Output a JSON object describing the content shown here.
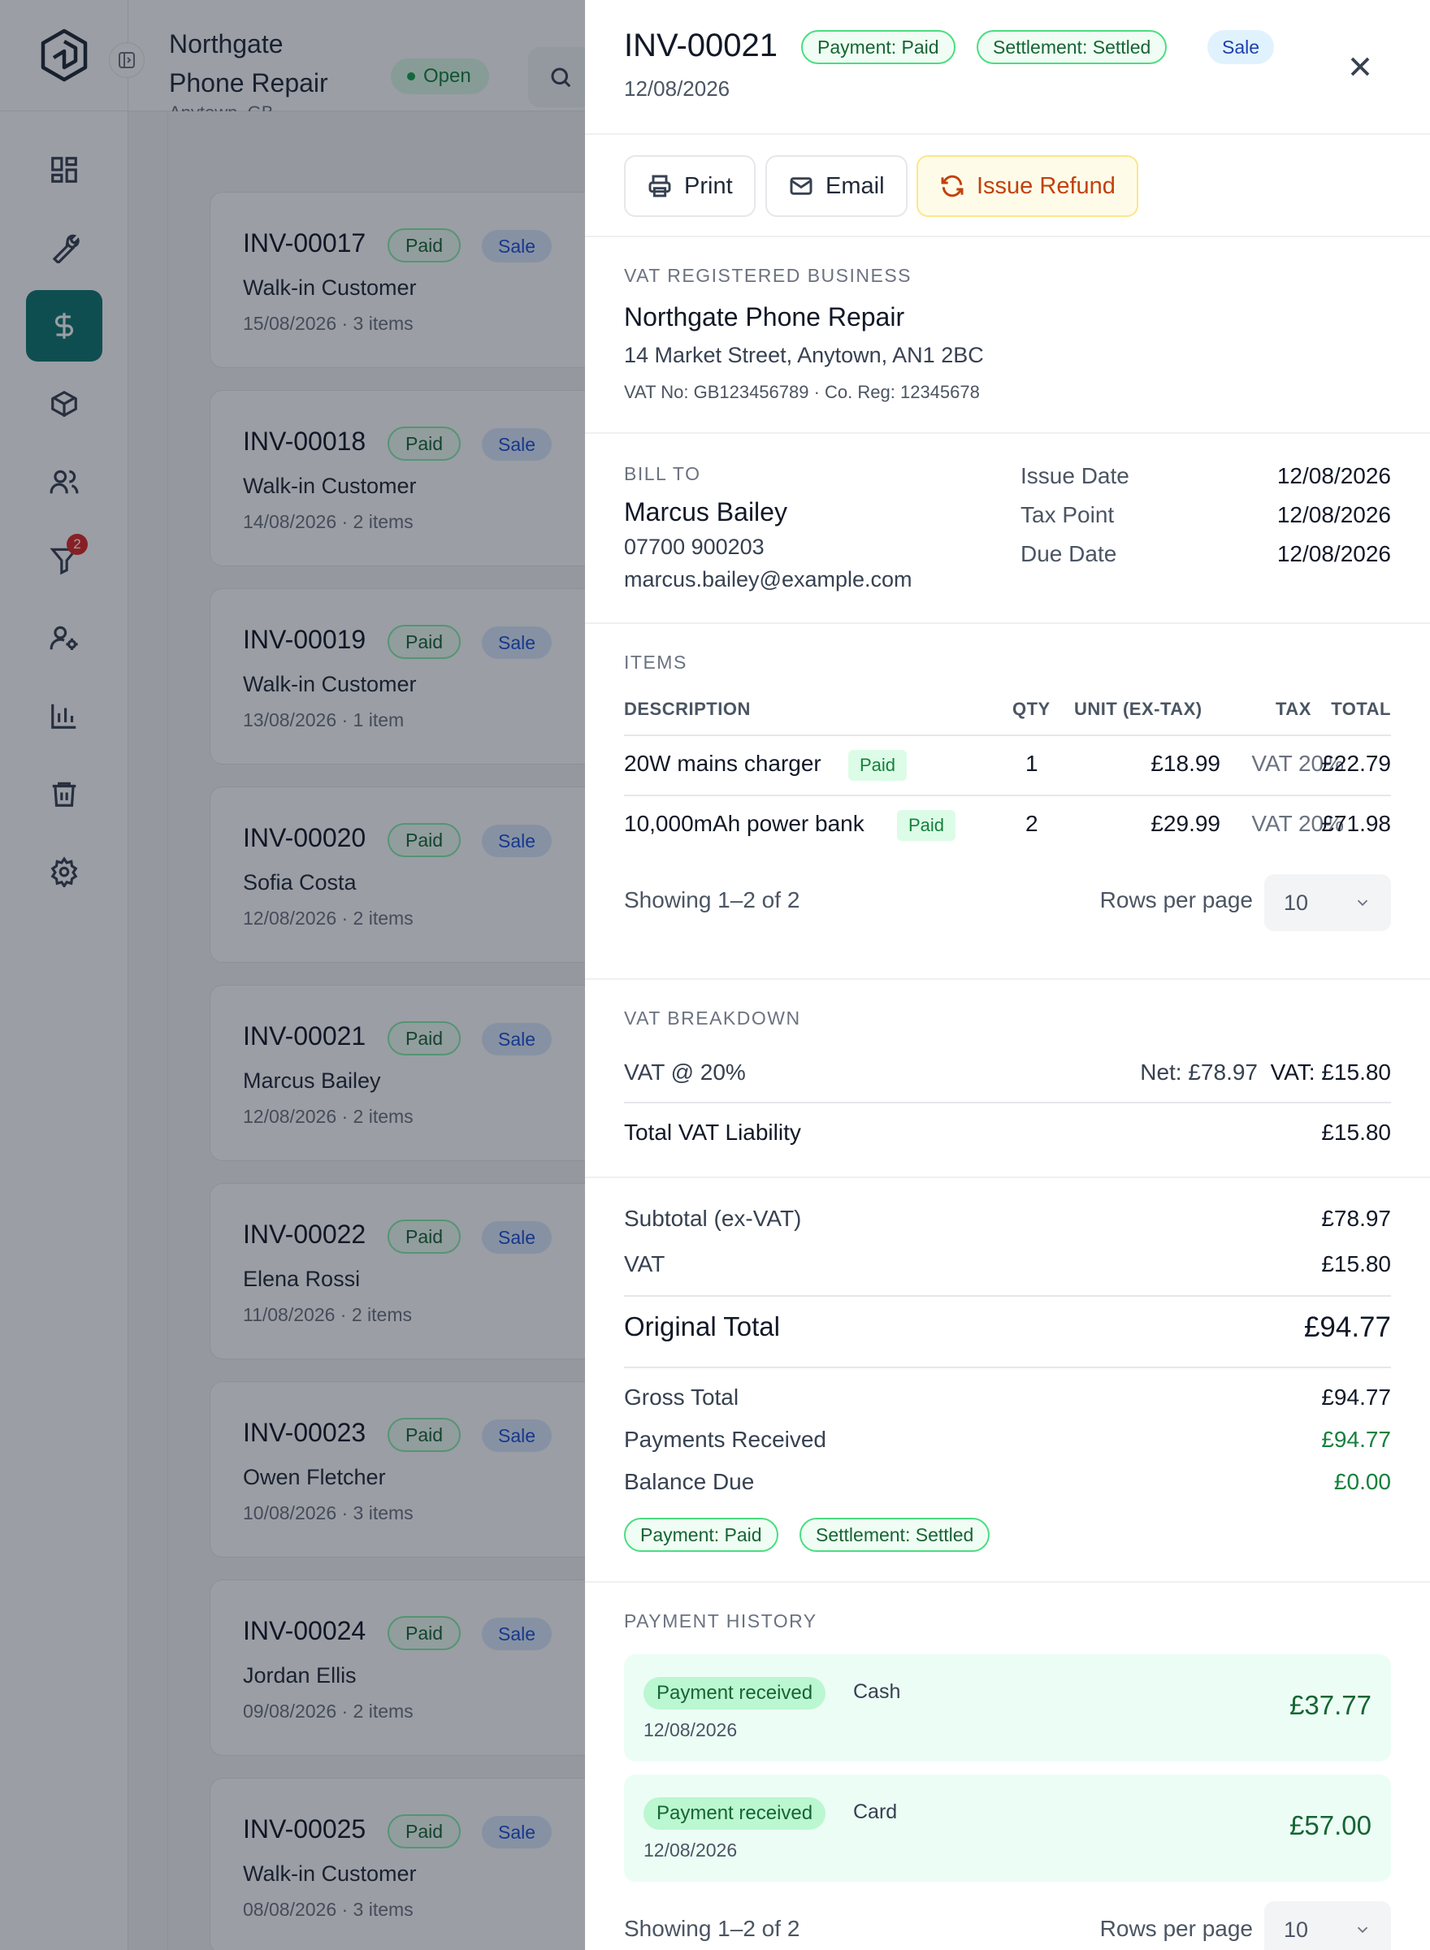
{
  "shell": {
    "shop_name": "Northgate Phone Repair",
    "shop_location": "Anytown, GB",
    "status": "Open",
    "nav_badge": "2"
  },
  "nav_icons": [
    "dashboard-icon",
    "wrench-icon",
    "dollar-icon",
    "box-icon",
    "users-icon",
    "filter-icon",
    "user-settings-icon",
    "bar-chart-icon",
    "trash-icon",
    "gear-icon"
  ],
  "invoice_list": [
    {
      "number": "INV-00017",
      "status": "Paid",
      "type": "Sale",
      "customer": "Walk-in Customer",
      "meta": "15/08/2026 · 3 items"
    },
    {
      "number": "INV-00018",
      "status": "Paid",
      "type": "Sale",
      "customer": "Walk-in Customer",
      "meta": "14/08/2026 · 2 items"
    },
    {
      "number": "INV-00019",
      "status": "Paid",
      "type": "Sale",
      "customer": "Walk-in Customer",
      "meta": "13/08/2026 · 1 item"
    },
    {
      "number": "INV-00020",
      "status": "Paid",
      "type": "Sale",
      "customer": "Sofia Costa",
      "meta": "12/08/2026 · 2 items"
    },
    {
      "number": "INV-00021",
      "status": "Paid",
      "type": "Sale",
      "customer": "Marcus Bailey",
      "meta": "12/08/2026 · 2 items"
    },
    {
      "number": "INV-00022",
      "status": "Paid",
      "type": "Sale",
      "customer": "Elena Rossi",
      "meta": "11/08/2026 · 2 items"
    },
    {
      "number": "INV-00023",
      "status": "Paid",
      "type": "Sale",
      "customer": "Owen Fletcher",
      "meta": "10/08/2026 · 3 items"
    },
    {
      "number": "INV-00024",
      "status": "Paid",
      "type": "Sale",
      "customer": "Jordan Ellis",
      "meta": "09/08/2026 · 2 items"
    },
    {
      "number": "INV-00025",
      "status": "Paid",
      "type": "Sale",
      "customer": "Walk-in Customer",
      "meta": "08/08/2026 · 3 items"
    }
  ],
  "drawer": {
    "title": "INV-00021",
    "date": "12/08/2026",
    "chips": {
      "payment": "Payment: Paid",
      "settlement": "Settlement: Settled",
      "type": "Sale"
    },
    "actions": {
      "print": "Print",
      "email": "Email",
      "refund": "Issue Refund"
    },
    "business": {
      "label": "VAT REGISTERED BUSINESS",
      "name": "Northgate Phone Repair",
      "address": "14 Market Street, Anytown, AN1 2BC",
      "vat_line": "VAT No: GB123456789 · Co. Reg: 12345678"
    },
    "bill_to": {
      "label": "BILL TO",
      "name": "Marcus Bailey",
      "phone": "07700 900203",
      "email": "marcus.bailey@example.com"
    },
    "dates": {
      "issue_label": "Issue Date",
      "issue": "12/08/2026",
      "tax_label": "Tax Point",
      "tax": "12/08/2026",
      "due_label": "Due Date",
      "due": "12/08/2026"
    },
    "items": {
      "label": "ITEMS",
      "headers": {
        "desc": "DESCRIPTION",
        "qty": "QTY",
        "unit": "UNIT (EX-TAX)",
        "tax": "TAX",
        "total": "TOTAL"
      },
      "rows": [
        {
          "desc": "20W mains charger",
          "status": "Paid",
          "qty": "1",
          "unit": "£18.99",
          "tax": "VAT 20%",
          "total": "£22.79"
        },
        {
          "desc": "10,000mAh power bank",
          "status": "Paid",
          "qty": "2",
          "unit": "£29.99",
          "tax": "VAT 20%",
          "total": "£71.98"
        }
      ],
      "showing": "Showing 1–2 of 2",
      "rows_per_page_label": "Rows per page",
      "rows_per_page": "10"
    },
    "vat": {
      "label": "VAT BREAKDOWN",
      "rate_label": "VAT @ 20%",
      "net": "Net: £78.97",
      "vat": "VAT: £15.80",
      "liability_label": "Total VAT Liability",
      "liability": "£15.80"
    },
    "totals": {
      "subtotal_label": "Subtotal (ex-VAT)",
      "subtotal": "£78.97",
      "vat_label": "VAT",
      "vat": "£15.80",
      "original_label": "Original Total",
      "original": "£94.77",
      "gross_label": "Gross Total",
      "gross": "£94.77",
      "payments_label": "Payments Received",
      "payments": "£94.77",
      "balance_label": "Balance Due",
      "balance": "£0.00",
      "chip_payment": "Payment: Paid",
      "chip_settlement": "Settlement: Settled"
    },
    "payments": {
      "label": "PAYMENT HISTORY",
      "entries": [
        {
          "status": "Payment received",
          "method": "Cash",
          "date": "12/08/2026",
          "amount": "£37.77"
        },
        {
          "status": "Payment received",
          "method": "Card",
          "date": "12/08/2026",
          "amount": "£57.00"
        }
      ],
      "showing": "Showing 1–2 of 2",
      "rows_per_page_label": "Rows per page",
      "rows_per_page": "10"
    }
  },
  "colors": {
    "accent": "#0f766e",
    "success": "#15803d",
    "refund": "#c2410c"
  }
}
